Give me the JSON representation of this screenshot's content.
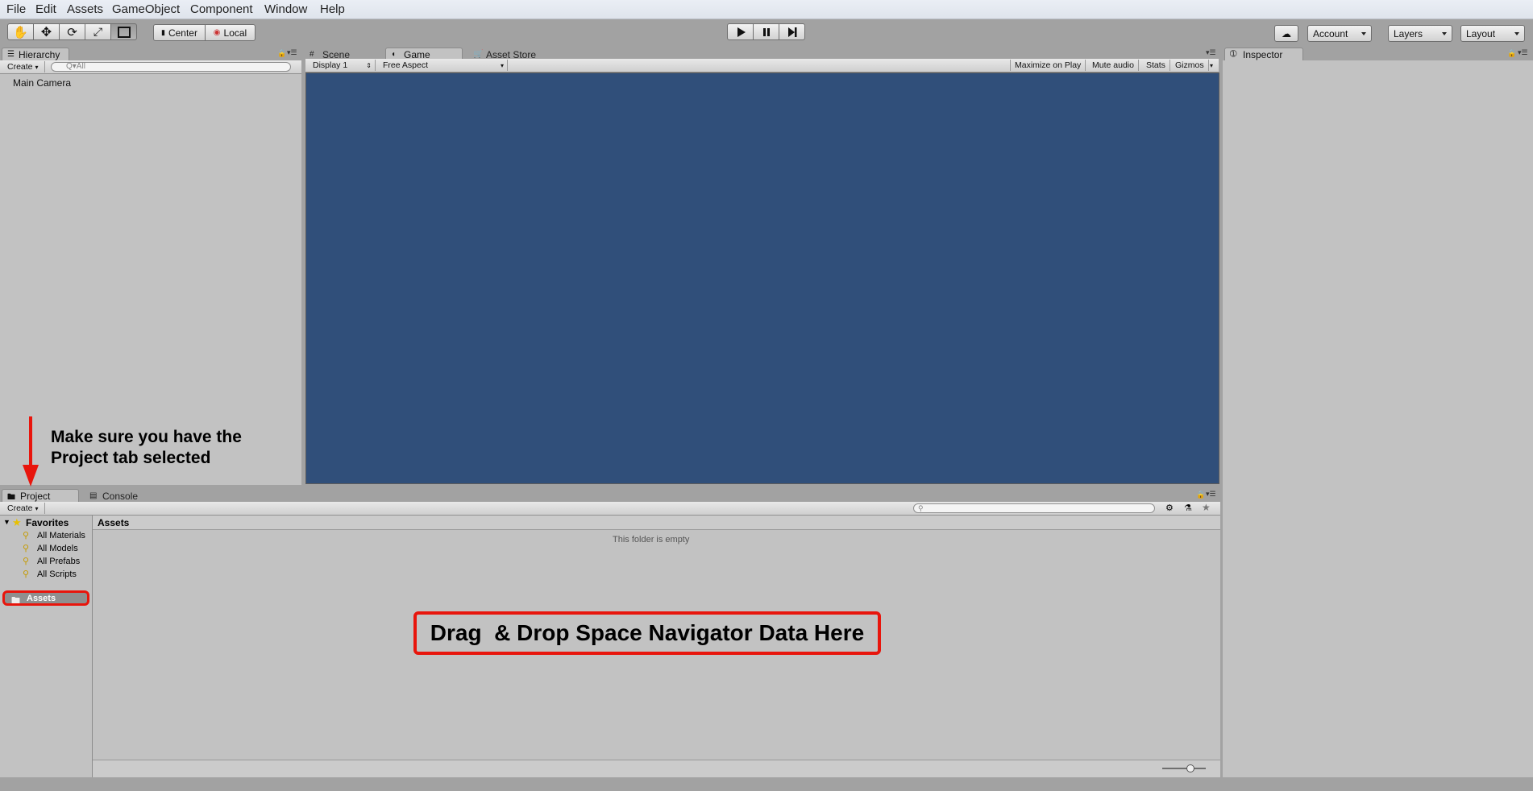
{
  "menu": [
    "File",
    "Edit",
    "Assets",
    "GameObject",
    "Component",
    "Window",
    "Help"
  ],
  "toolbar": {
    "tools": [
      "hand-tool-icon",
      "move-tool-icon",
      "rotate-tool-icon",
      "scale-tool-icon",
      "rect-tool-icon"
    ],
    "pivot_label": "Center",
    "space_label": "Local",
    "account_label": "Account",
    "layers_label": "Layers",
    "layout_label": "Layout"
  },
  "hierarchy": {
    "tab_label": "Hierarchy",
    "create_label": "Create",
    "search_placeholder": "Q▾All",
    "items": [
      "Main Camera"
    ]
  },
  "game": {
    "tabs": [
      "Scene",
      "Game",
      "Asset Store"
    ],
    "display_label": "Display 1",
    "aspect_label": "Free Aspect",
    "options": [
      "Maximize on Play",
      "Mute audio",
      "Stats",
      "Gizmos"
    ],
    "background_color": "#304f7a"
  },
  "inspector": {
    "tab_label": "Inspector"
  },
  "project": {
    "tabs": [
      "Project",
      "Console"
    ],
    "create_label": "Create",
    "favorites_label": "Favorites",
    "favorites": [
      "All Materials",
      "All Models",
      "All Prefabs",
      "All Scripts"
    ],
    "assets_folder_label": "Assets",
    "breadcrumb": "Assets",
    "empty_message": "This folder is empty"
  },
  "annotations": {
    "project_note_line1": "Make sure you have the",
    "project_note_line2": "Project tab selected",
    "drop_note": "Drag  & Drop Space Navigator Data Here",
    "highlight_color": "#e8150c"
  }
}
